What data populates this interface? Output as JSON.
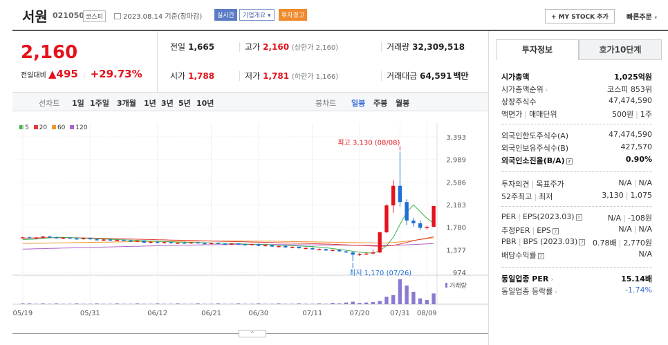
{
  "header": {
    "name": "서원",
    "code": "021050",
    "market": "코스피",
    "date_text": "2023.08.14 기준(장마감)",
    "badge_realtime": "실시간",
    "badge_corp": "기업개요",
    "badge_warning": "투자경고",
    "my_stock": "+ MY STOCK 추가",
    "quick_order": "빠른주문"
  },
  "price": {
    "current": "2,160",
    "change_label": "전일대비",
    "change_value": "495",
    "change_pct": "+29.73%"
  },
  "stats": {
    "prev_label": "전일",
    "prev_value": "1,665",
    "high_label": "고가",
    "high_value": "2,160",
    "high_sub": "(상한가 2,160)",
    "volume_label": "거래량",
    "volume_value": "32,309,518",
    "open_label": "시가",
    "open_value": "1,788",
    "low_label": "저가",
    "low_value": "1,781",
    "low_sub": "(하한가 1,166)",
    "amount_label": "거래대금",
    "amount_value": "64,591",
    "amount_unit": "백만"
  },
  "toolbar": {
    "line_label": "선차트",
    "periods": [
      "1일",
      "1주일",
      "3개월",
      "1년",
      "3년",
      "5년",
      "10년"
    ],
    "candle_label": "봉차트",
    "candle_periods": [
      "일봉",
      "주봉",
      "월봉"
    ],
    "active_candle": "일봉"
  },
  "colors": {
    "up": "#e4121c",
    "down": "#1e6fd9",
    "ma5": "#3fb34f",
    "ma20": "#e33b3b",
    "ma60": "#f0962e",
    "ma120": "#b061c8"
  },
  "chart_data": {
    "type": "candlestick",
    "legend": [
      "5",
      "20",
      "60",
      "120"
    ],
    "y_ticks": [
      974,
      1377,
      1780,
      2183,
      2586,
      2989,
      3393
    ],
    "ylim": [
      974,
      3393
    ],
    "x_ticks": [
      "05/19",
      "05/31",
      "06/12",
      "06/21",
      "06/30",
      "07/11",
      "07/20",
      "07/31",
      "08/09"
    ],
    "annotations": {
      "high": "최고 3,130 (08/08)",
      "low": "최저 1,170 (07/26)"
    },
    "volume_label": "거래량",
    "candles": [
      [
        1595,
        1610,
        1580,
        1600
      ],
      [
        1600,
        1612,
        1585,
        1590
      ],
      [
        1590,
        1605,
        1575,
        1598
      ],
      [
        1598,
        1620,
        1590,
        1615
      ],
      [
        1615,
        1625,
        1595,
        1600
      ],
      [
        1600,
        1610,
        1580,
        1585
      ],
      [
        1585,
        1600,
        1570,
        1595
      ],
      [
        1595,
        1605,
        1575,
        1580
      ],
      [
        1580,
        1595,
        1565,
        1570
      ],
      [
        1570,
        1590,
        1560,
        1585
      ],
      [
        1585,
        1595,
        1560,
        1565
      ],
      [
        1565,
        1575,
        1545,
        1550
      ],
      [
        1550,
        1570,
        1540,
        1560
      ],
      [
        1560,
        1570,
        1540,
        1545
      ],
      [
        1545,
        1560,
        1530,
        1555
      ],
      [
        1555,
        1565,
        1535,
        1540
      ],
      [
        1540,
        1555,
        1525,
        1530
      ],
      [
        1530,
        1545,
        1515,
        1540
      ],
      [
        1540,
        1550,
        1500,
        1505
      ],
      [
        1505,
        1530,
        1495,
        1520
      ],
      [
        1520,
        1530,
        1495,
        1500
      ],
      [
        1500,
        1520,
        1490,
        1515
      ],
      [
        1515,
        1525,
        1490,
        1495
      ],
      [
        1495,
        1510,
        1480,
        1505
      ],
      [
        1505,
        1520,
        1490,
        1500
      ],
      [
        1500,
        1515,
        1485,
        1510
      ],
      [
        1510,
        1520,
        1490,
        1495
      ],
      [
        1495,
        1510,
        1480,
        1490
      ],
      [
        1490,
        1505,
        1475,
        1500
      ],
      [
        1500,
        1510,
        1480,
        1485
      ],
      [
        1485,
        1500,
        1470,
        1480
      ],
      [
        1480,
        1495,
        1465,
        1490
      ],
      [
        1490,
        1500,
        1470,
        1475
      ],
      [
        1475,
        1490,
        1460,
        1470
      ],
      [
        1470,
        1485,
        1455,
        1480
      ],
      [
        1480,
        1490,
        1440,
        1450
      ],
      [
        1450,
        1470,
        1440,
        1460
      ],
      [
        1460,
        1470,
        1430,
        1435
      ],
      [
        1435,
        1450,
        1420,
        1445
      ],
      [
        1445,
        1455,
        1415,
        1420
      ],
      [
        1420,
        1440,
        1405,
        1430
      ],
      [
        1430,
        1440,
        1400,
        1405
      ],
      [
        1405,
        1420,
        1390,
        1410
      ],
      [
        1410,
        1420,
        1380,
        1385
      ],
      [
        1385,
        1400,
        1370,
        1390
      ],
      [
        1390,
        1400,
        1360,
        1365
      ],
      [
        1365,
        1380,
        1350,
        1375
      ],
      [
        1375,
        1385,
        1345,
        1350
      ],
      [
        1350,
        1365,
        1320,
        1330
      ],
      [
        1330,
        1345,
        1170,
        1290
      ],
      [
        1290,
        1320,
        1270,
        1300
      ],
      [
        1300,
        1340,
        1290,
        1310
      ],
      [
        1310,
        1380,
        1300,
        1330
      ],
      [
        1330,
        1700,
        1320,
        1690
      ],
      [
        1690,
        2190,
        1680,
        2170
      ],
      [
        2170,
        2620,
        2040,
        2520
      ],
      [
        2520,
        3130,
        2150,
        2230
      ],
      [
        2230,
        2280,
        1820,
        1900
      ],
      [
        1900,
        1950,
        1790,
        1850
      ],
      [
        1850,
        1900,
        1730,
        1770
      ],
      [
        1770,
        1810,
        1740,
        1788
      ],
      [
        1788,
        2160,
        1781,
        2160
      ]
    ],
    "volume": [
      2,
      2,
      1,
      2,
      1,
      2,
      1,
      1,
      2,
      1,
      1,
      2,
      1,
      1,
      2,
      1,
      1,
      2,
      1,
      1,
      2,
      1,
      1,
      2,
      1,
      1,
      2,
      1,
      1,
      2,
      1,
      1,
      2,
      1,
      1,
      2,
      1,
      1,
      2,
      1,
      1,
      2,
      1,
      1,
      2,
      1,
      3,
      2,
      4,
      6,
      3,
      4,
      5,
      8,
      18,
      22,
      60,
      45,
      30,
      14,
      10,
      26
    ],
    "ma5": [
      1560,
      1565,
      1570,
      1580,
      1590,
      1600,
      1600,
      1595,
      1590,
      1585,
      1580,
      1575,
      1570,
      1565,
      1560,
      1555,
      1550,
      1545,
      1540,
      1535,
      1530,
      1525,
      1520,
      1515,
      1512,
      1510,
      1508,
      1505,
      1500,
      1498,
      1495,
      1490,
      1485,
      1480,
      1478,
      1475,
      1470,
      1465,
      1460,
      1455,
      1450,
      1445,
      1440,
      1435,
      1425,
      1415,
      1400,
      1385,
      1370,
      1350,
      1335,
      1325,
      1320,
      1360,
      1450,
      1600,
      1830,
      2050,
      2180,
      2060,
      1940,
      1850
    ],
    "ma20": [
      1585,
      1588,
      1590,
      1592,
      1593,
      1594,
      1594,
      1593,
      1592,
      1590,
      1588,
      1585,
      1582,
      1579,
      1576,
      1573,
      1570,
      1567,
      1564,
      1561,
      1558,
      1555,
      1552,
      1549,
      1546,
      1543,
      1540,
      1537,
      1534,
      1531,
      1528,
      1525,
      1522,
      1519,
      1516,
      1513,
      1510,
      1507,
      1504,
      1501,
      1498,
      1495,
      1492,
      1488,
      1484,
      1480,
      1476,
      1471,
      1466,
      1461,
      1456,
      1450,
      1444,
      1440,
      1445,
      1455,
      1480,
      1510,
      1540,
      1565,
      1585,
      1610
    ],
    "ma60": [
      1490,
      1492,
      1494,
      1496,
      1498,
      1500,
      1502,
      1504,
      1506,
      1508,
      1510,
      1512,
      1514,
      1516,
      1518,
      1520,
      1522,
      1524,
      1525,
      1526,
      1527,
      1528,
      1529,
      1530,
      1531,
      1532,
      1533,
      1534,
      1534,
      1535,
      1535,
      1535,
      1535,
      1534,
      1533,
      1532,
      1531,
      1530,
      1529,
      1527,
      1525,
      1523,
      1521,
      1519,
      1517,
      1515,
      1513,
      1511,
      1509,
      1507,
      1505,
      1503,
      1501,
      1500,
      1502,
      1508,
      1518,
      1530,
      1545,
      1560,
      1575,
      1590
    ],
    "ma120": [
      1390,
      1393,
      1396,
      1399,
      1402,
      1405,
      1408,
      1411,
      1414,
      1417,
      1420,
      1423,
      1426,
      1429,
      1432,
      1435,
      1438,
      1441,
      1444,
      1447,
      1450,
      1453,
      1456,
      1458,
      1460,
      1462,
      1464,
      1466,
      1468,
      1469,
      1470,
      1471,
      1472,
      1472,
      1472,
      1472,
      1472,
      1471,
      1470,
      1469,
      1468,
      1467,
      1466,
      1465,
      1464,
      1463,
      1462,
      1461,
      1460,
      1459,
      1458,
      1457,
      1456,
      1455,
      1456,
      1458,
      1462,
      1467,
      1472,
      1478,
      1484,
      1490
    ]
  },
  "side": {
    "tab_active": "투자정보",
    "tab_inactive": "호가10단계",
    "rows": [
      {
        "label": "시가총액",
        "value": "1,025억원",
        "strong": true
      },
      {
        "label": "시가총액순위",
        "value": "코스피 853위",
        "chev": true
      },
      {
        "label": "상장주식수",
        "value": "47,474,590"
      },
      {
        "label": "액면가",
        "label2": "매매단위",
        "value": "500원",
        "value2": "1주"
      },
      {
        "label": "외국인한도주식수(A)",
        "value": "47,474,590"
      },
      {
        "label": "외국인보유주식수(B)",
        "value": "427,570"
      },
      {
        "label": "외국인소진율(B/A)",
        "value": "0.90%",
        "strong": true,
        "q": true
      },
      {
        "label": "투자의견",
        "label2": "목표주가",
        "value": "N/A",
        "value2": "N/A"
      },
      {
        "label": "52주최고",
        "label2": "최저",
        "value": "3,130",
        "value2": "1,075"
      },
      {
        "label": "PER",
        "label2": "EPS(2023.03)",
        "value": "N/A",
        "value2": "-108원",
        "q": true
      },
      {
        "label": "추정PER",
        "label2": "EPS",
        "value": "N/A",
        "value2": "N/A",
        "q": true
      },
      {
        "label": "PBR",
        "label2": "BPS (2023.03)",
        "value": "0.78배",
        "value2": "2,770원",
        "q": true
      },
      {
        "label": "배당수익률",
        "value": "N/A",
        "q": true
      },
      {
        "label": "동일업종 PER",
        "value": "15.14배",
        "strong": true,
        "chev": true
      },
      {
        "label": "동일업종 등락률",
        "value": "-1.74%",
        "blue": true,
        "chev": true
      }
    ]
  },
  "collapse": "⌃"
}
